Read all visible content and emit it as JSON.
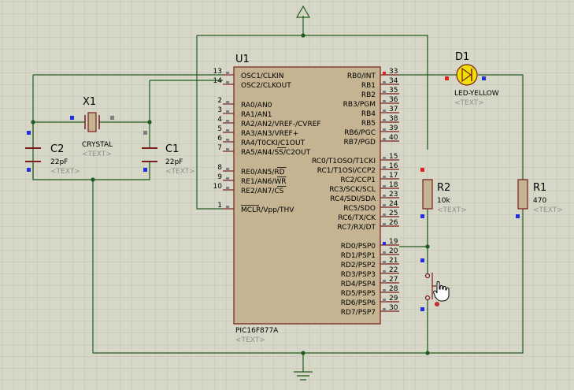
{
  "colors": {
    "background": "#d7d7c7",
    "grid": "#c4c4b2",
    "wire": "#1f5c1f",
    "body_fill": "#c4b491",
    "body_stroke": "#7a1d1d",
    "pin_num": "#000000",
    "text_hint": "#8f8f8f",
    "pin_red": "#e02020",
    "pin_blue": "#2030e0",
    "pin_gray": "#808080",
    "led_fill": "#f0e000"
  },
  "ic": {
    "ref": "U1",
    "part": "PIC16F877A",
    "text_hint": "<TEXT>",
    "left_pins": [
      {
        "num": "13",
        "name": "OSC1/CLKIN"
      },
      {
        "num": "14",
        "name": "OSC2/CLKOUT"
      },
      {
        "num": "2",
        "name": "RA0/AN0"
      },
      {
        "num": "3",
        "name": "RA1/AN1"
      },
      {
        "num": "4",
        "name": "RA2/AN2/VREF-/CVREF"
      },
      {
        "num": "5",
        "name": "RA3/AN3/VREF+"
      },
      {
        "num": "6",
        "name": "RA4/T0CKI/C1OUT"
      },
      {
        "num": "7",
        "name": "RA5/AN4/SS/C2OUT"
      },
      {
        "num": "8",
        "name": "RE0/AN5/RD"
      },
      {
        "num": "9",
        "name": "RE1/AN6/WR"
      },
      {
        "num": "10",
        "name": "RE2/AN7/CS"
      },
      {
        "num": "1",
        "name": "MCLR/Vpp/THV"
      }
    ],
    "right_pins": [
      {
        "num": "33",
        "name": "RB0/INT"
      },
      {
        "num": "34",
        "name": "RB1"
      },
      {
        "num": "35",
        "name": "RB2"
      },
      {
        "num": "36",
        "name": "RB3/PGM"
      },
      {
        "num": "37",
        "name": "RB4"
      },
      {
        "num": "38",
        "name": "RB5"
      },
      {
        "num": "39",
        "name": "RB6/PGC"
      },
      {
        "num": "40",
        "name": "RB7/PGD"
      },
      {
        "num": "15",
        "name": "RC0/T1OSO/T1CKI"
      },
      {
        "num": "16",
        "name": "RC1/T1OSI/CCP2"
      },
      {
        "num": "17",
        "name": "RC2/CCP1"
      },
      {
        "num": "18",
        "name": "RC3/SCK/SCL"
      },
      {
        "num": "23",
        "name": "RC4/SDI/SDA"
      },
      {
        "num": "24",
        "name": "RC5/SDO"
      },
      {
        "num": "25",
        "name": "RC6/TX/CK"
      },
      {
        "num": "26",
        "name": "RC7/RX/DT"
      },
      {
        "num": "19",
        "name": "RD0/PSP0"
      },
      {
        "num": "20",
        "name": "RD1/PSP1"
      },
      {
        "num": "21",
        "name": "RD2/PSP2"
      },
      {
        "num": "22",
        "name": "RD3/PSP3"
      },
      {
        "num": "27",
        "name": "RD4/PSP4"
      },
      {
        "num": "28",
        "name": "RD5/PSP5"
      },
      {
        "num": "29",
        "name": "RD6/PSP6"
      },
      {
        "num": "30",
        "name": "RD7/PSP7"
      }
    ]
  },
  "x1": {
    "ref": "X1",
    "value": "CRYSTAL",
    "text_hint": "<TEXT>"
  },
  "c1": {
    "ref": "C1",
    "value": "22pF",
    "text_hint": "<TEXT>"
  },
  "c2": {
    "ref": "C2",
    "value": "22pF",
    "text_hint": "<TEXT>"
  },
  "d1": {
    "ref": "D1",
    "value": "LED-YELLOW",
    "text_hint": "<TEXT>"
  },
  "r1": {
    "ref": "R1",
    "value": "470",
    "text_hint": "<TEXT>"
  },
  "r2": {
    "ref": "R2",
    "value": "10k",
    "text_hint": "<TEXT>"
  }
}
